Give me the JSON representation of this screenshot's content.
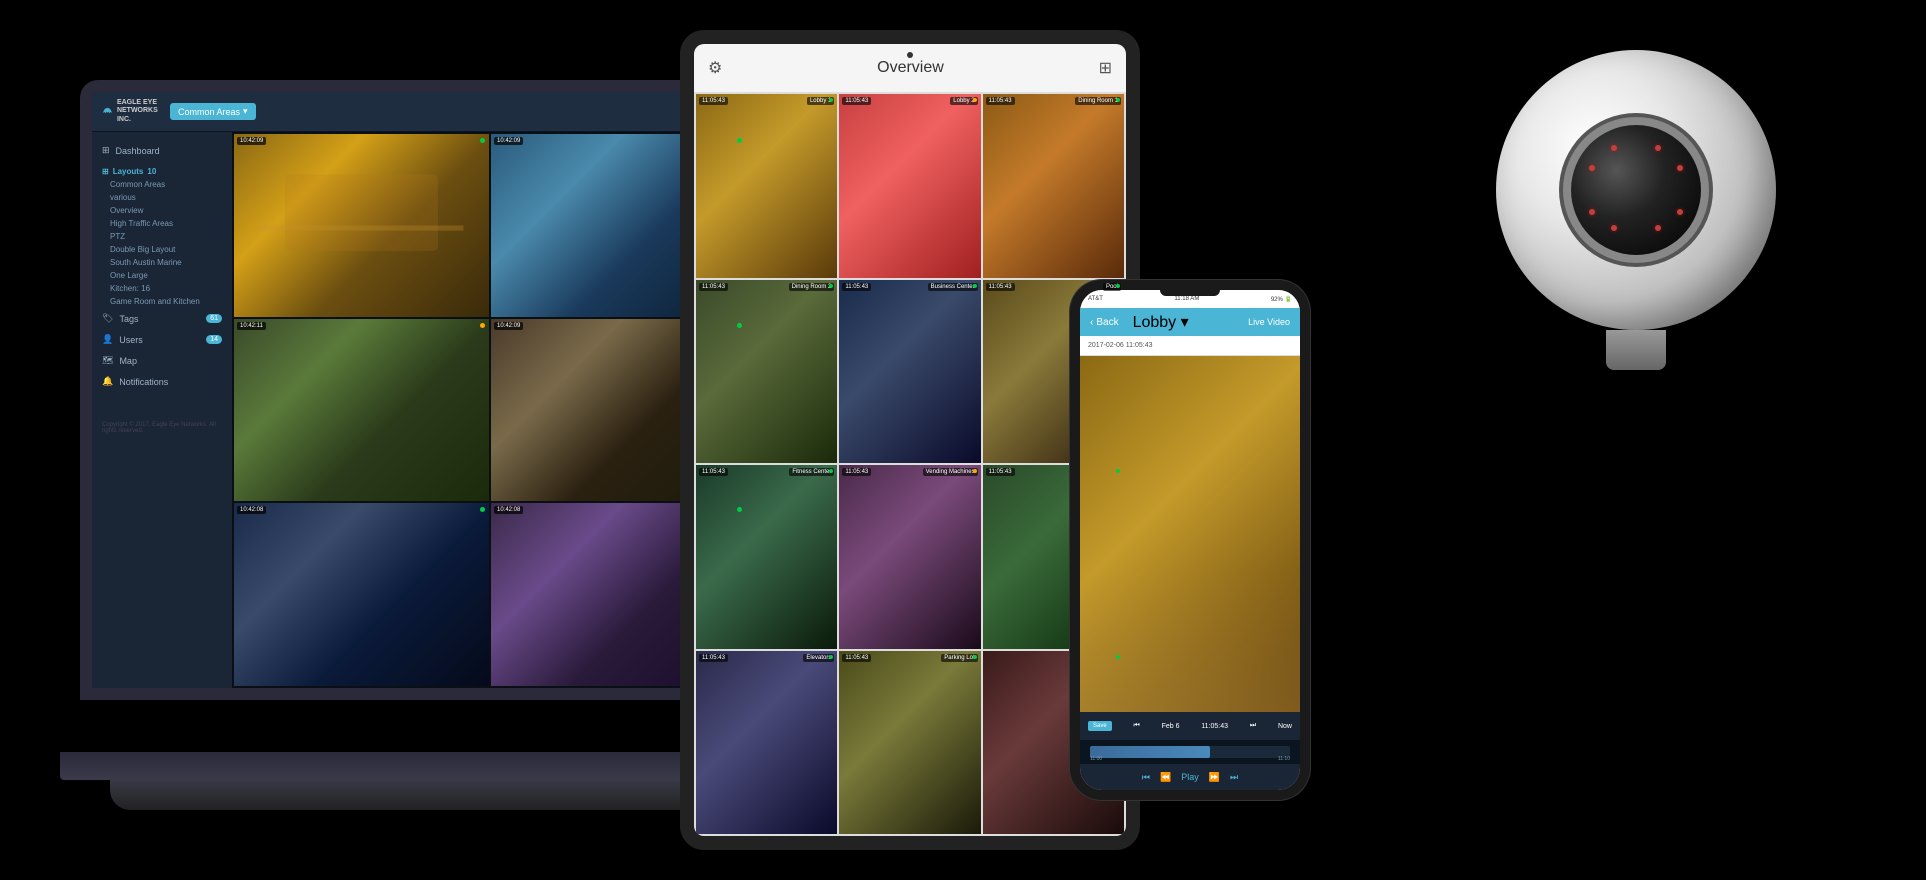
{
  "app": {
    "title": "Eagle Eye Networks",
    "logo_text": "EAGLE EYE\nNETWORKS INC.",
    "common_areas_label": "Common Areas"
  },
  "sidebar": {
    "dashboard_label": "Dashboard",
    "layouts_label": "Layouts",
    "layouts_badge": "10",
    "tags_label": "Tags",
    "tags_badge": "61",
    "users_label": "Users",
    "users_badge": "14",
    "map_label": "Map",
    "notifications_label": "Notifications",
    "layout_items": [
      "Common Areas",
      "various",
      "Overview",
      "High Traffic Areas",
      "PTZ",
      "Double Big Layout",
      "South Austin Marine",
      "One Large",
      "Kitchen: 16",
      "Game Room and Kitchen"
    ],
    "copyright": "Copyright © 2017, Eagle Eye Networks.\nAll rights reserved."
  },
  "laptop_cameras": [
    {
      "timestamp": "10:42:09",
      "indicator": "green"
    },
    {
      "timestamp": "10:42:09",
      "indicator": "green"
    },
    {
      "timestamp": "10:42:11",
      "indicator": "yellow"
    },
    {
      "timestamp": "10:42:09",
      "indicator": "green"
    },
    {
      "timestamp": "10:42:08",
      "indicator": "green"
    },
    {
      "timestamp": "10:42:08",
      "indicator": "green"
    }
  ],
  "tablet": {
    "title": "Overview",
    "cameras": [
      {
        "time": "11:05:43",
        "name": "Lobby 1"
      },
      {
        "time": "11:05:43",
        "name": "Lobby 2"
      },
      {
        "time": "11:05:43",
        "name": "Dining Room 1"
      },
      {
        "time": "11:05:43",
        "name": "Dining Room 2"
      },
      {
        "time": "11:05:43",
        "name": "Business Center"
      },
      {
        "time": "11:05:43",
        "name": "Pool"
      },
      {
        "time": "11:05:43",
        "name": "Fitness Center"
      },
      {
        "time": "11:05:43",
        "name": "Vending Machines"
      },
      {
        "time": "11:05:43",
        "name": ""
      },
      {
        "time": "11:05:43",
        "name": "Elevators"
      },
      {
        "time": "11:05:43",
        "name": "Parking Lot"
      },
      {
        "time": "",
        "name": ""
      }
    ]
  },
  "phone": {
    "carrier": "AT&T",
    "time": "11:18 AM",
    "battery": "92%",
    "back_label": "Back",
    "nav_title": "Lobby",
    "nav_right": "Live Video",
    "date_label": "2017-02-06 11:05:43",
    "save_label": "Save",
    "controls_left": "Feb 6",
    "controls_time": "11:05:43",
    "controls_now": "Now",
    "timeline_left": "11:00",
    "timeline_right": "11:10",
    "play_label": "Play"
  }
}
